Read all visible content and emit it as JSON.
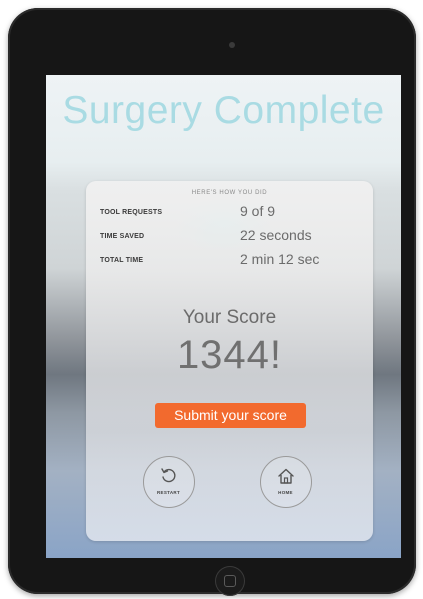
{
  "screen": {
    "title": "Surgery Complete"
  },
  "card": {
    "heading": "HERE'S HOW YOU DID",
    "stats": [
      {
        "label": "TOOL REQUESTS",
        "value": "9 of 9"
      },
      {
        "label": "TIME SAVED",
        "value": "22 seconds"
      },
      {
        "label": "TOTAL TIME",
        "value": "2 min 12 sec"
      }
    ],
    "score_label": "Your Score",
    "score_value": "1344!",
    "submit_label": "Submit your score",
    "restart_label": "RESTART",
    "home_label": "HOME"
  },
  "colors": {
    "title": "#a9dbe3",
    "accent_button": "#f26a2e",
    "device_frame": "#161616"
  },
  "icons": {
    "restart": "restart-icon",
    "home": "home-icon"
  }
}
